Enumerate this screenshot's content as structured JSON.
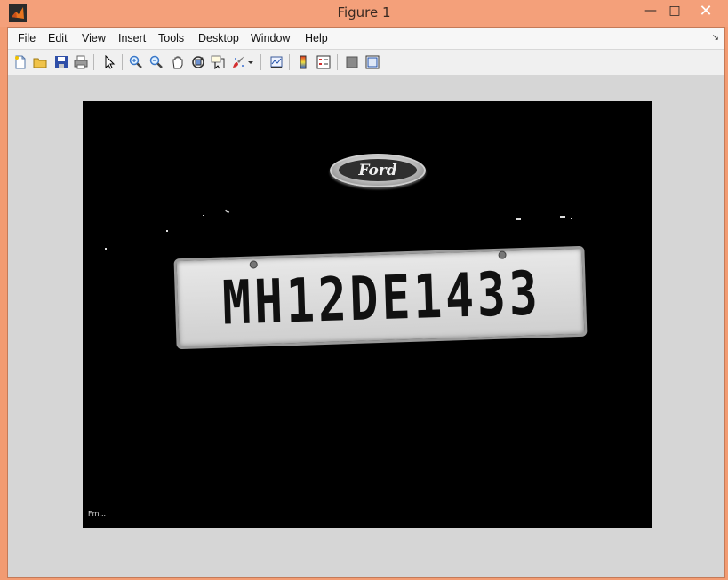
{
  "window": {
    "title": "Figure 1",
    "min_symbol": "—",
    "max_symbol": "□",
    "close_symbol": "✕"
  },
  "menu": {
    "items": [
      "File",
      "Edit",
      "View",
      "Insert",
      "Tools",
      "Desktop",
      "Window",
      "Help"
    ],
    "overflow_symbol": "↘"
  },
  "toolbar": {
    "icons": [
      "new-figure-icon",
      "open-file-icon",
      "save-icon",
      "print-icon",
      "edit-plot-arrow-icon",
      "zoom-in-icon",
      "zoom-out-icon",
      "pan-hand-icon",
      "rotate-3d-icon",
      "data-cursor-icon",
      "brush-icon",
      "brush-dropdown-icon",
      "link-plot-icon",
      "colorbar-icon",
      "legend-icon",
      "hide-plot-tools-icon",
      "show-plot-tools-icon"
    ]
  },
  "figure": {
    "emblem_text": "Ford",
    "plate_text": "MH12DE1433",
    "corner_text": "Fm..."
  },
  "colors": {
    "titlebar": "#f4a07a",
    "frame": "#d6d6d6",
    "plot_bg": "#000000"
  }
}
